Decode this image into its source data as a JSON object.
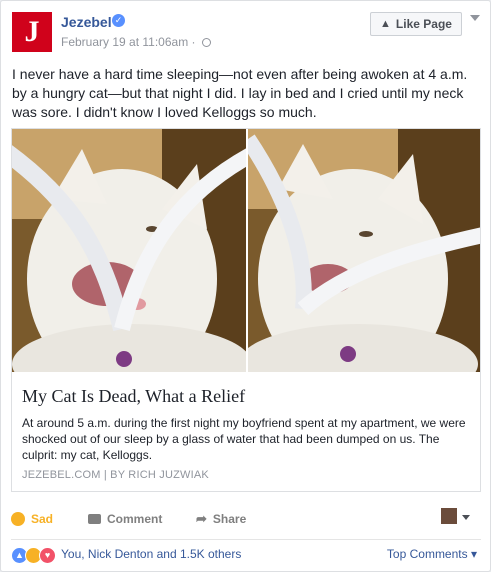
{
  "page": {
    "name": "Jezebel",
    "avatar_letter": "J",
    "brand_color": "#d0021b",
    "verified_icon": "check-badge-icon"
  },
  "post": {
    "timestamp": "February 19 at 11:06am",
    "privacy_icon": "globe-icon",
    "text": "I never have a hard time sleeping—not even after being awoken at 4 a.m. by a hungry cat—but that night I did. I lay in bed and I cried until my neck was sore. I didn't know I loved Kelloggs so much."
  },
  "header": {
    "like_page_label": "Like Page",
    "like_icon": "thumbs-up-icon"
  },
  "link": {
    "title": "My Cat Is Dead, What a Relief",
    "description": "At around 5 a.m. during the first night my boyfriend spent at my apartment, we were shocked out of our sleep by a glass of water that had been dumped on us. The culprit: my cat, Kelloggs.",
    "source": "JEZEBEL.COM  |  BY RICH JUZWIAK"
  },
  "actions": {
    "sad_label": "Sad",
    "comment_label": "Comment",
    "share_label": "Share"
  },
  "reactions": {
    "icons": [
      "like",
      "sad",
      "love"
    ],
    "summary": "You, Nick Denton and 1.5K others",
    "top_comments_label": "Top Comments"
  },
  "colors": {
    "link_blue": "#365899",
    "sad_yellow": "#f7b125",
    "like_blue": "#5890ff",
    "love_red": "#f25268"
  }
}
